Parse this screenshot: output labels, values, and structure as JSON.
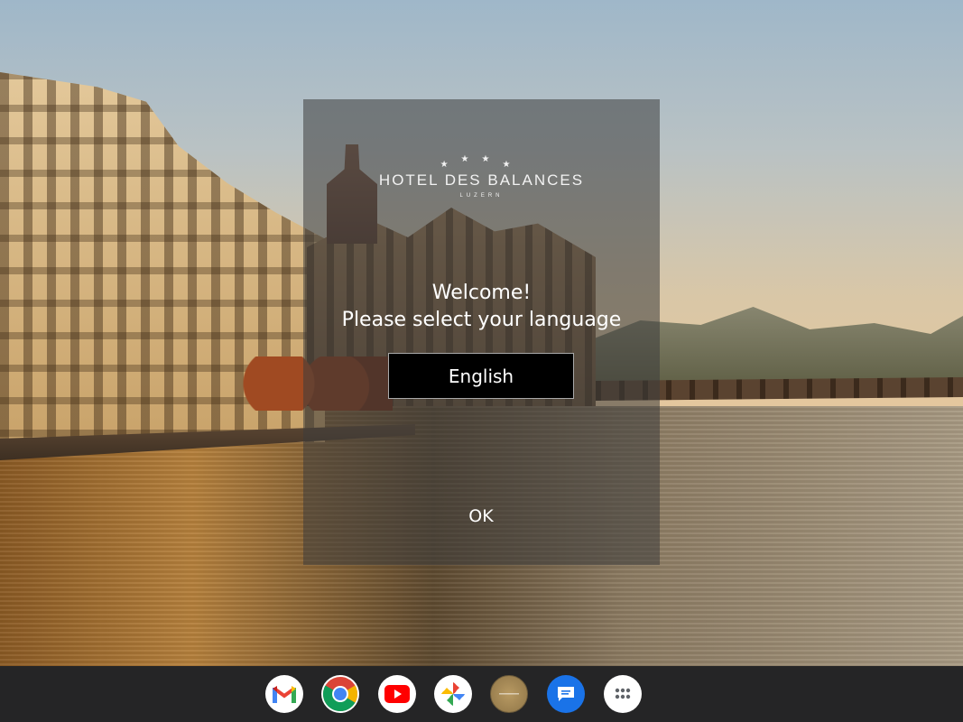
{
  "dialog": {
    "logo": {
      "stars": [
        "★",
        "★",
        "★",
        "★"
      ],
      "name": "HOTEL DES BALANCES",
      "city": "LUZERN"
    },
    "welcome_line1": "Welcome!",
    "welcome_line2": "Please select your language",
    "language_value": "English",
    "ok_label": "OK"
  },
  "shelf": {
    "apps": [
      {
        "icon": "gmail-icon"
      },
      {
        "icon": "chrome-icon"
      },
      {
        "icon": "youtube-icon"
      },
      {
        "icon": "google-photos-icon"
      },
      {
        "icon": "hotel-app-icon"
      },
      {
        "icon": "messages-icon"
      },
      {
        "icon": "app-launcher-icon"
      }
    ]
  },
  "colors": {
    "shelf_background": "#252526",
    "select_background": "#000000",
    "dialog_overlay": "rgba(60,60,60,0.55)"
  }
}
